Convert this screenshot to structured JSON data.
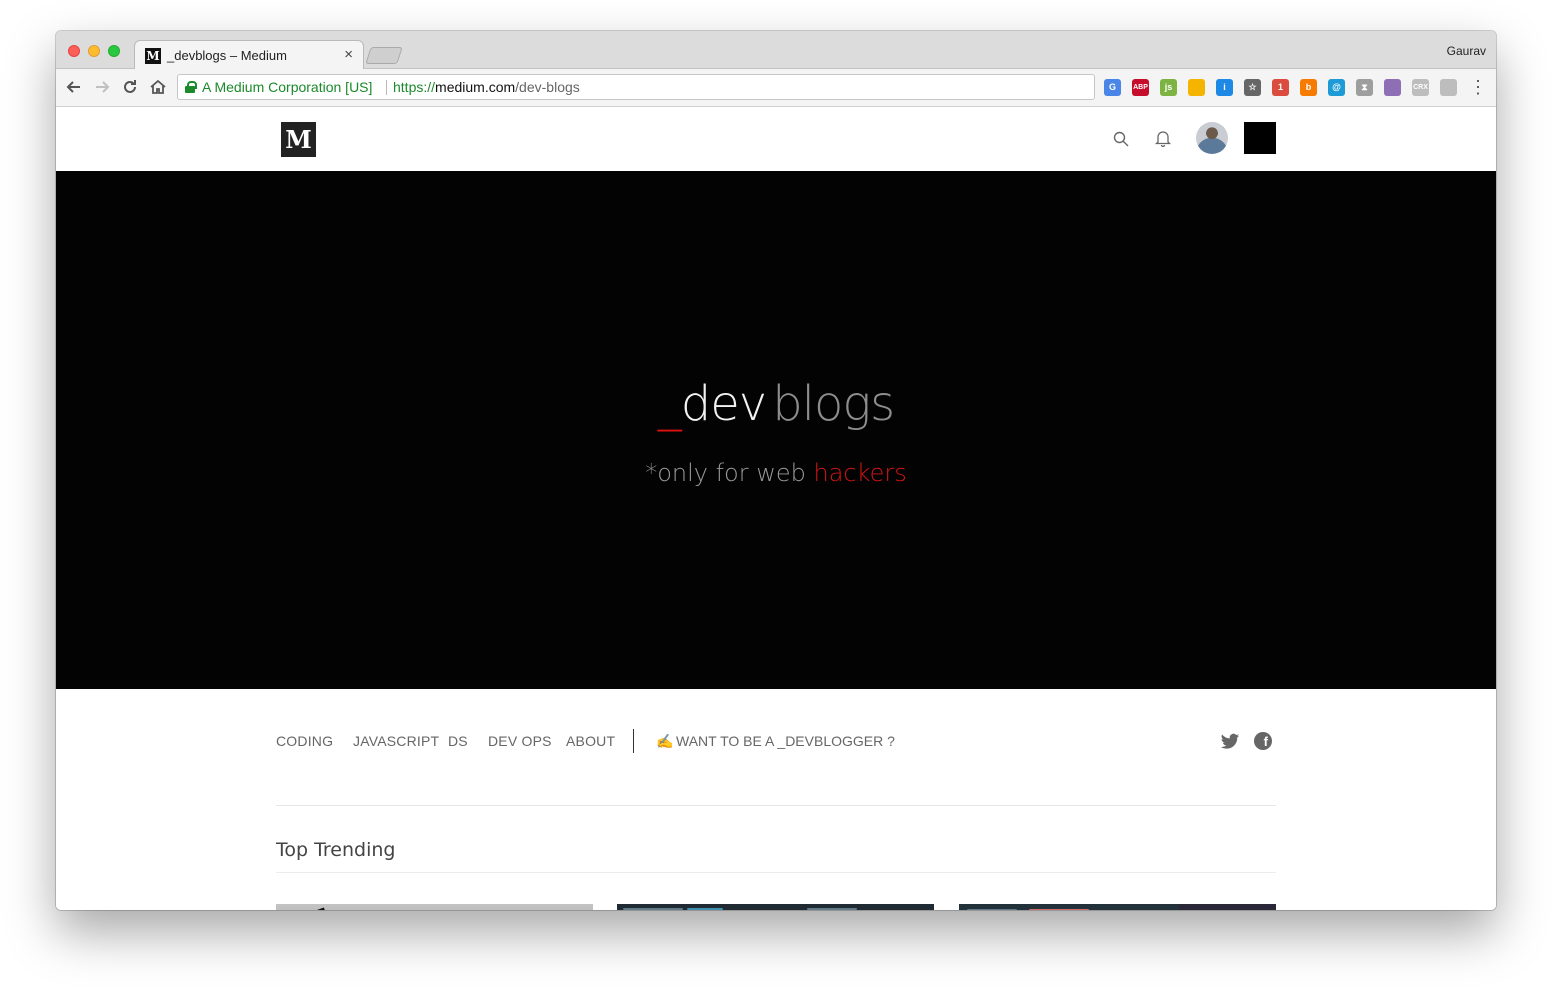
{
  "browser": {
    "tab_title": "_devblogs – Medium",
    "tab_favicon": "M",
    "tab_close": "×",
    "profile_name": "Gaurav",
    "security_label": "A Medium Corporation [US]",
    "url_scheme": "https://",
    "url_host": "medium.com",
    "url_path": "/dev-blogs",
    "extensions": [
      {
        "name": "google-translate-icon",
        "label": "G",
        "color": "#4a86e8"
      },
      {
        "name": "adblock-plus-icon",
        "label": "ABP",
        "color": "#c70d2c"
      },
      {
        "name": "nodejs-icon",
        "label": "js",
        "color": "#7cb342"
      },
      {
        "name": "chart-extension-icon",
        "label": "",
        "color": "#f4b400"
      },
      {
        "name": "info-extension-icon",
        "label": "i",
        "color": "#1e88e5"
      },
      {
        "name": "bookmark-star-icon",
        "label": "☆",
        "color": "#666666"
      },
      {
        "name": "todoist-icon",
        "label": "1",
        "color": "#db4c3f"
      },
      {
        "name": "pocket-extension-icon",
        "label": "b",
        "color": "#f57c00"
      },
      {
        "name": "at-extension-icon",
        "label": "@",
        "color": "#1e9bd7"
      },
      {
        "name": "hourglass-icon",
        "label": "⧗",
        "color": "#9e9e9e"
      },
      {
        "name": "octocat-icon",
        "label": "",
        "color": "#8e6fb5"
      },
      {
        "name": "crx-icon",
        "label": "CRX",
        "color": "#bdbdbd"
      },
      {
        "name": "react-devtools-icon",
        "label": "",
        "color": "#bdbdbd"
      }
    ],
    "menu_icon": "⋮"
  },
  "site": {
    "logo": "M"
  },
  "hero": {
    "title_underscore": "_",
    "title_dev": "dev",
    "title_blogs": "blogs",
    "subtitle_main": "*only for web ",
    "subtitle_accent": "hackers"
  },
  "nav": {
    "links": [
      "CODING",
      "JAVASCRIPT",
      "DS",
      "DEV OPS",
      "ABOUT"
    ],
    "cta_icon": "✍",
    "cta_label": "WANT TO BE A _DEVBLOGGER ?"
  },
  "section": {
    "title": "Top Trending"
  },
  "colors": {
    "accent_red": "#e01010",
    "hero_bg": "#030303",
    "secure_green": "#1b8a2a"
  }
}
